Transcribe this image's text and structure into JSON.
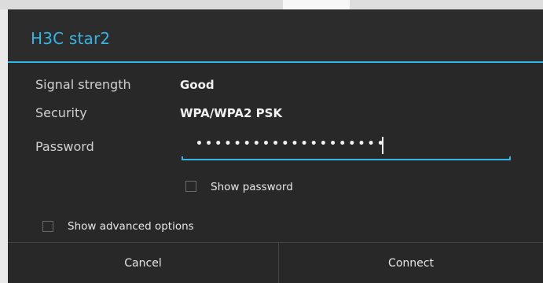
{
  "dialog": {
    "title": "H3C star2",
    "fields": [
      {
        "label": "Signal strength",
        "value": "Good"
      },
      {
        "label": "Security",
        "value": "WPA/WPA2 PSK"
      }
    ],
    "password": {
      "label": "Password",
      "masked_value": "••••••••••••••••••••"
    },
    "show_password": {
      "label": "Show password",
      "checked": false
    },
    "show_advanced": {
      "label": "Show advanced options",
      "checked": false
    },
    "buttons": {
      "cancel": "Cancel",
      "connect": "Connect"
    }
  },
  "colors": {
    "accent": "#33b5e5",
    "dialog_background": "#282828",
    "text": "#d9d9d9"
  }
}
